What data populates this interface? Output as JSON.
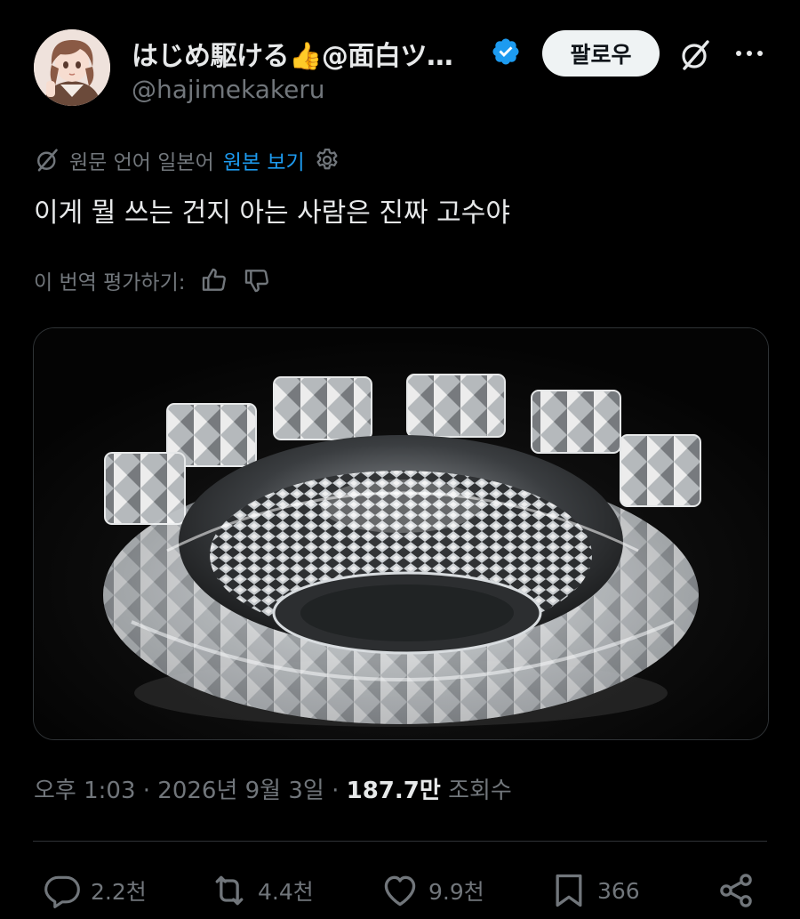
{
  "author": {
    "display_name": "はじめ駆ける👍@面白ツ…",
    "handle": "@hajimekakeru",
    "verified": true,
    "follow_label": "팔로우"
  },
  "translation": {
    "source_notice": "원문 언어 일본어",
    "show_original_label": "원본 보기",
    "rate_label": "이 번역 평가하기:"
  },
  "tweet": {
    "text": "이게 뭘 쓰는 건지 아는 사람은 진짜 고수야",
    "timestamp": "오후 1:03 · 2026년 9월 3일 ·",
    "views_count": "187.7만",
    "views_label": "조회수"
  },
  "actions": {
    "replies": "2.2천",
    "reposts": "4.4천",
    "likes": "9.9천",
    "bookmarks": "366"
  },
  "colors": {
    "background": "#000000",
    "text_primary": "#e7e9ea",
    "text_secondary": "#71767b",
    "link": "#1d9bf0",
    "verified_badge": "#1d9bf0",
    "follow_button_bg": "#eff3f4"
  }
}
